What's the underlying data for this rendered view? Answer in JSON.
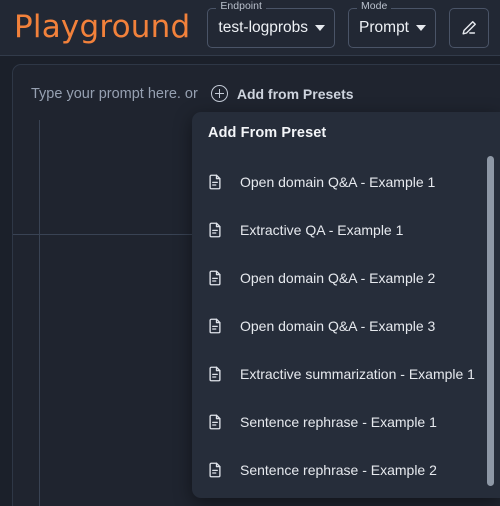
{
  "header": {
    "app_title": "Playground",
    "endpoint_select": {
      "label": "Endpoint",
      "value": "test-logprobs",
      "caret_icon": "chevron-down-icon"
    },
    "mode_select": {
      "label": "Mode",
      "value": "Prompt",
      "caret_icon": "chevron-down-icon"
    },
    "edit_button": {
      "icon": "pencil-edit-icon"
    }
  },
  "prompt_panel": {
    "placeholder": "Type your prompt here. or",
    "add_presets_link": {
      "icon": "plus-circle-icon",
      "label": "Add from Presets"
    }
  },
  "preset_menu": {
    "title": "Add From Preset",
    "item_icon": "document-icon",
    "items": [
      {
        "label": "Open domain Q&A - Example 1"
      },
      {
        "label": "Extractive QA - Example 1"
      },
      {
        "label": "Open domain Q&A - Example 2"
      },
      {
        "label": "Open domain Q&A - Example 3"
      },
      {
        "label": "Extractive summarization - Example 1"
      },
      {
        "label": "Sentence rephrase - Example 1"
      },
      {
        "label": "Sentence rephrase - Example 2"
      }
    ]
  },
  "colors": {
    "page_background": "#1b202a",
    "header_background": "#222834",
    "panel_background": "#1f242f",
    "menu_background": "#262d3a",
    "accent_orange": "#f2813b",
    "text_primary": "#e6e9ee",
    "text_muted": "#96a0b1",
    "border": "#4a5467",
    "scrollbar_thumb": "#8e98a6"
  }
}
